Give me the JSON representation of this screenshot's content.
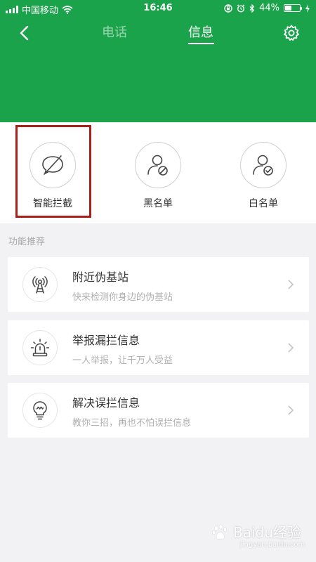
{
  "status_bar": {
    "carrier": "中国移动",
    "time": "16:46",
    "battery_percent": "44%",
    "battery_level": 0.44,
    "icons": [
      "signal-icon",
      "wifi-icon",
      "rotation-lock-icon",
      "alarm-icon",
      "bluetooth-icon",
      "battery-icon",
      "charging-icon"
    ]
  },
  "nav": {
    "back_icon": "back-icon",
    "tabs": [
      {
        "label": "电话",
        "active": false
      },
      {
        "label": "信息",
        "active": true
      }
    ],
    "settings_icon": "gear-icon"
  },
  "colors": {
    "header_green": "#1aa34a",
    "highlight_red": "#a8201a",
    "background": "#f2f2f4"
  },
  "features": [
    {
      "label": "智能拦截",
      "icon": "smart-block-icon",
      "highlighted": true
    },
    {
      "label": "黑名单",
      "icon": "blacklist-icon",
      "highlighted": false
    },
    {
      "label": "白名单",
      "icon": "whitelist-icon",
      "highlighted": false
    }
  ],
  "recommend": {
    "section_title": "功能推荐",
    "items": [
      {
        "title": "附近伪基站",
        "subtitle": "快来检测你身边的伪基站",
        "icon": "base-station-icon"
      },
      {
        "title": "举报漏拦信息",
        "subtitle": "一人举报，让千万人受益",
        "icon": "alarm-light-icon"
      },
      {
        "title": "解决误拦信息",
        "subtitle": "教你三招，再也不怕误拦信息",
        "icon": "lightbulb-icon"
      }
    ]
  },
  "watermark": {
    "text": "Baidu经验",
    "subtext": "jingyan.baidu.com"
  }
}
